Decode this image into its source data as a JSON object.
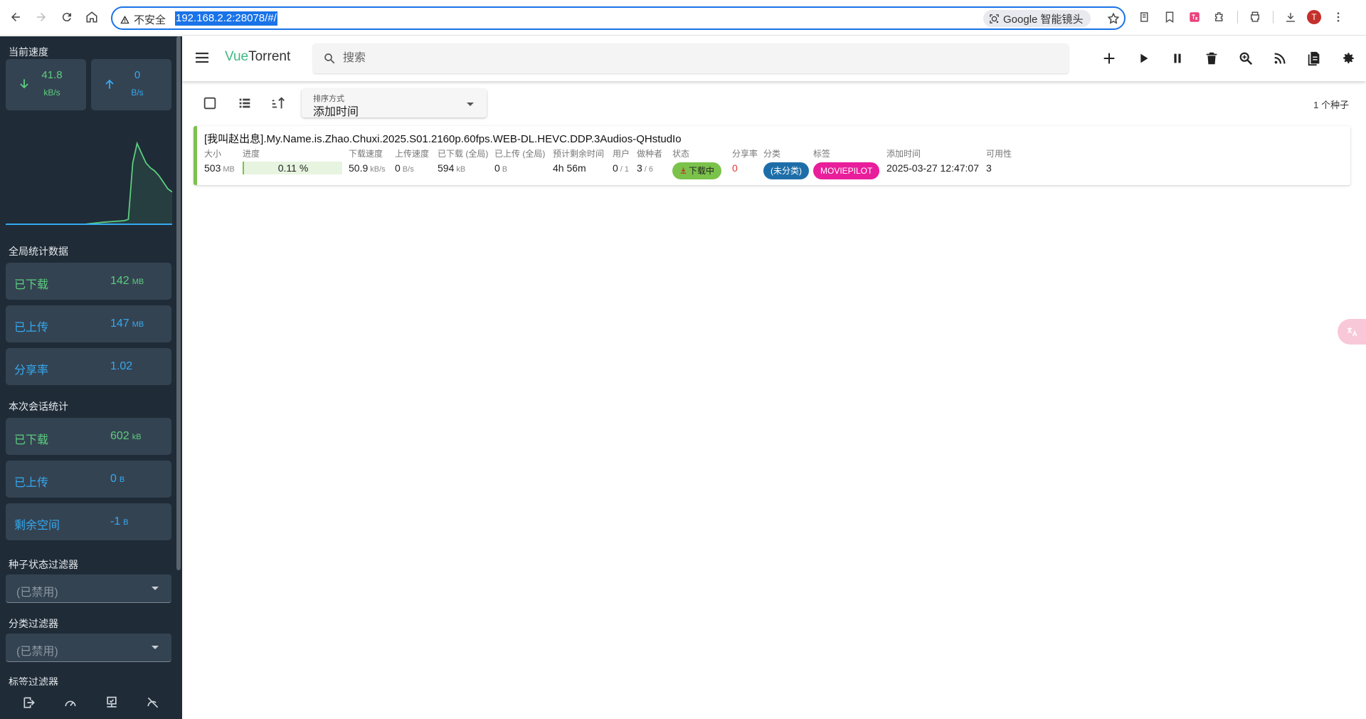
{
  "browser": {
    "security_label": "不安全",
    "url": "192.168.2.2:28078/#/",
    "lens_label": "Google 智能镜头",
    "avatar_initial": "T"
  },
  "sidebar": {
    "current_speed_title": "当前速度",
    "download_speed": {
      "value": "41.8",
      "unit": "kB/s"
    },
    "upload_speed": {
      "value": "0",
      "unit": "B/s"
    },
    "global_stats_title": "全局统计数据",
    "global_stats": [
      {
        "label": "已下载",
        "value": "142",
        "unit": "MB",
        "color": "green"
      },
      {
        "label": "已上传",
        "value": "147",
        "unit": "MB",
        "color": "blue"
      },
      {
        "label": "分享率",
        "value": "1.02",
        "unit": "",
        "color": "blue"
      }
    ],
    "session_stats_title": "本次会话统计",
    "session_stats": [
      {
        "label": "已下载",
        "value": "602",
        "unit": "kB",
        "color": "green"
      },
      {
        "label": "已上传",
        "value": "0",
        "unit": "B",
        "color": "blue"
      },
      {
        "label": "剩余空间",
        "value": "-1",
        "unit": "B",
        "color": "blue"
      }
    ],
    "state_filter_title": "种子状态过滤器",
    "state_filter_value": "(已禁用)",
    "category_filter_title": "分类过滤器",
    "category_filter_value": "(已禁用)",
    "tag_filter_title": "标签过滤器",
    "bottom_icons": [
      "logout-icon",
      "speedometer-icon",
      "connection-icon",
      "speed-limit-off-icon"
    ]
  },
  "appbar": {
    "brand_vue": "Vue",
    "brand_torrent": "Torrent",
    "search_placeholder": "搜索",
    "actions": [
      "add-icon",
      "play-icon",
      "pause-icon",
      "delete-icon",
      "search-engine-icon",
      "rss-icon",
      "logs-icon",
      "settings-icon"
    ]
  },
  "toolbar": {
    "sort_label": "排序方式",
    "sort_value": "添加时间",
    "torrent_count": "1 个种子"
  },
  "torrent": {
    "name": "[我叫赵出息].My.Name.is.Zhao.Chuxi.2025.S01.2160p.60fps.WEB-DL.HEVC.DDP.3Audios-QHstudIo",
    "size_h": "大小",
    "size_v": "503",
    "size_u": "MB",
    "progress_h": "进度",
    "progress_v": "0.11 %",
    "progress_fraction": 0.0011,
    "dlspeed_h": "下载速度",
    "dlspeed_v": "50.9",
    "dlspeed_u": "kB/s",
    "upspeed_h": "上传速度",
    "upspeed_v": "0",
    "upspeed_u": "B/s",
    "downloaded_h": "已下载 (全局)",
    "downloaded_v": "594",
    "downloaded_u": "kB",
    "uploaded_h": "已上传 (全局)",
    "uploaded_v": "0",
    "uploaded_u": "B",
    "eta_h": "预计剩余时间",
    "eta_v": "4h 56m",
    "peers_h": "用户",
    "peers_v": "0",
    "peers_total": "/ 1",
    "seeds_h": "做种者",
    "seeds_v": "3",
    "seeds_total": "/ 6",
    "state_h": "状态",
    "state_v": "下载中",
    "ratio_h": "分享率",
    "ratio_v": "0",
    "category_h": "分类",
    "category_v": "(未分类)",
    "tags_h": "标签",
    "tags_v": "MOVIEPILOT",
    "added_h": "添加时间",
    "added_v": "2025-03-27 12:47:07",
    "availability_h": "可用性",
    "availability_v": "3"
  },
  "chart_data": {
    "type": "area",
    "series": [
      {
        "values": [
          0,
          0,
          0,
          0,
          0,
          0,
          0,
          0,
          0,
          0,
          0,
          0,
          0,
          0,
          0,
          0,
          0,
          0,
          0,
          0.3,
          0.6,
          0.9,
          1.2,
          1.4,
          1.6,
          1.8,
          2,
          2.2,
          3,
          38,
          50,
          44,
          38,
          35,
          33,
          30,
          26,
          22,
          20
        ]
      },
      {
        "values": [
          0,
          0,
          0,
          0,
          0,
          0,
          0,
          0,
          0,
          0,
          0,
          0,
          0,
          0,
          0,
          0,
          0,
          0,
          0,
          0,
          0,
          0,
          0,
          0,
          0,
          0,
          0,
          0,
          0,
          0,
          0,
          0,
          0,
          0,
          0,
          0,
          0,
          0,
          0
        ]
      }
    ],
    "colors": [
      "#5bce7e",
      "#34a9f0"
    ]
  }
}
